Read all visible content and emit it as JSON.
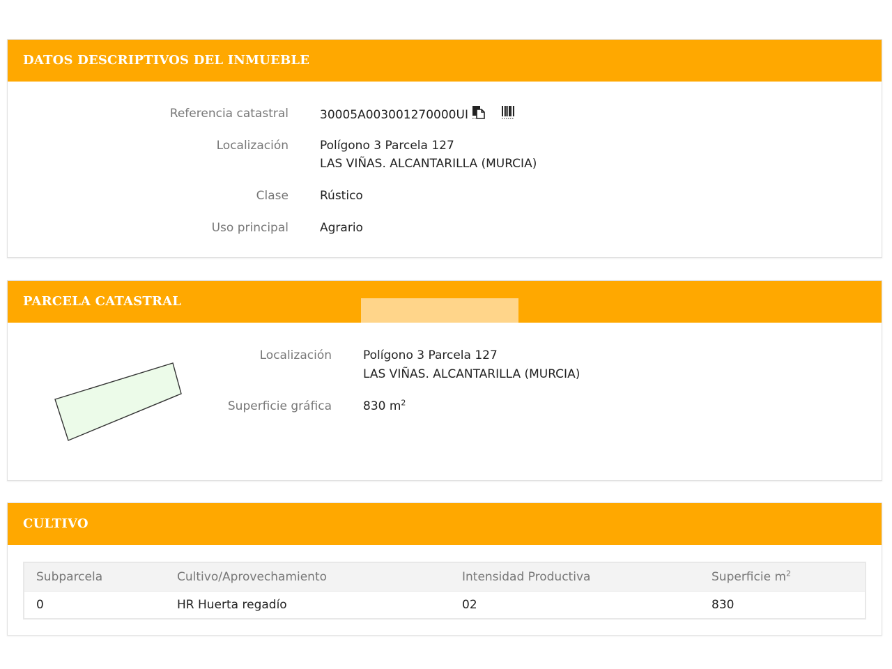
{
  "datos": {
    "title": "DATOS DESCRIPTIVOS DEL INMUEBLE",
    "referencia_label": "Referencia catastral",
    "referencia_value": "30005A003001270000UI",
    "copy_icon": "copy-document-icon",
    "barcode_icon": "barcode-icon",
    "localizacion_label": "Localización",
    "localizacion_line1": "Polígono 3 Parcela 127",
    "localizacion_line2": "LAS VIÑAS. ALCANTARILLA (MURCIA)",
    "clase_label": "Clase",
    "clase_value": "Rústico",
    "uso_label": "Uso principal",
    "uso_value": "Agrario"
  },
  "parcela": {
    "title": "PARCELA CATASTRAL",
    "localizacion_label": "Localización",
    "localizacion_line1": "Polígono 3 Parcela 127",
    "localizacion_line2": "LAS VIÑAS. ALCANTARILLA (MURCIA)",
    "superficie_label": "Superficie gráfica",
    "superficie_value": "830 m",
    "superficie_exp": "2"
  },
  "cultivo": {
    "title": "CULTIVO",
    "headers": [
      "Subparcela",
      "Cultivo/Aprovechamiento",
      "Intensidad Productiva",
      "Superficie m"
    ],
    "header_exp": "2",
    "rows": [
      [
        "0",
        "HR Huerta regadío",
        "02",
        "830"
      ]
    ]
  },
  "colors": {
    "header": "#ffa800",
    "parcel_fill": "#ecfbe9"
  }
}
